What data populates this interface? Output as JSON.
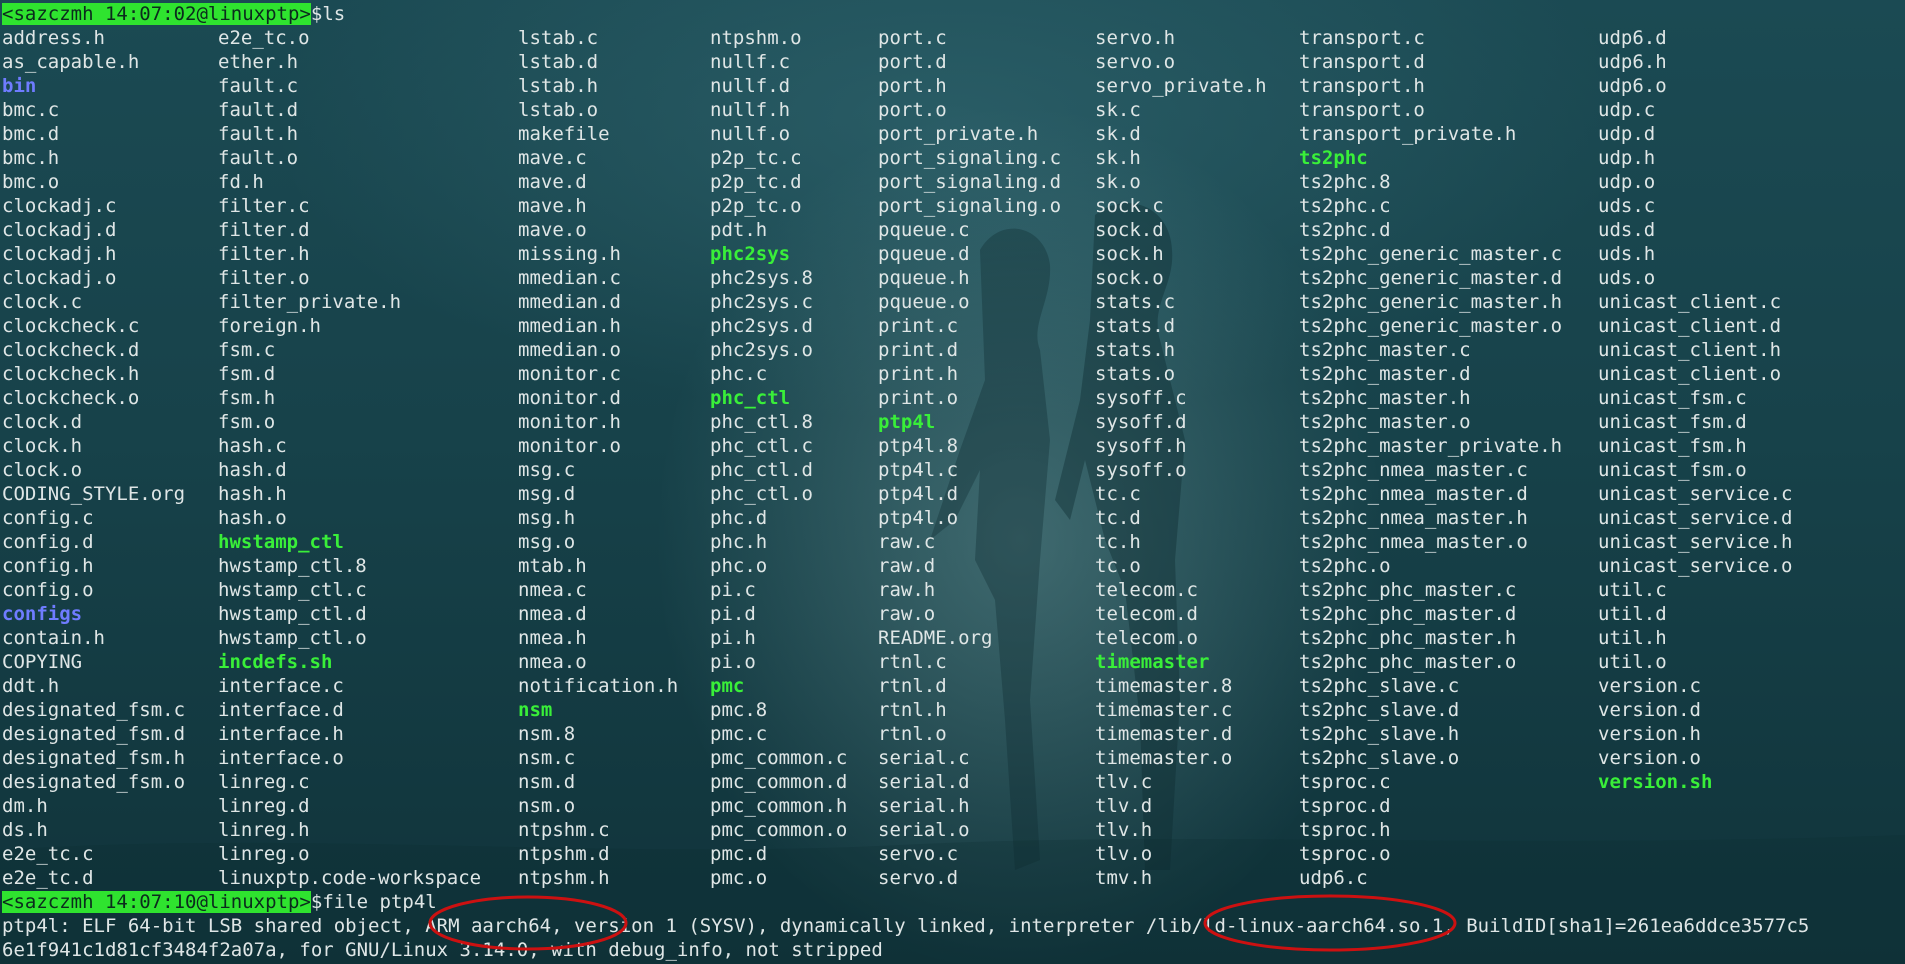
{
  "terminal": {
    "prompt1": {
      "user_host": "<sazczmh 14:07:02@linuxptp>",
      "dollar": "$",
      "command": "ls"
    },
    "prompt2": {
      "user_host": "<sazczmh 14:07:10@linuxptp>",
      "dollar": "$",
      "command": "file ptp4l"
    },
    "output_line1": "ptp4l: ELF 64-bit LSB shared object, ARM aarch64, version 1 (SYSV), dynamically linked, interpreter /lib/ld-linux-aarch64.so.1, BuildID[sha1]=261ea6ddce3577c5",
    "output_line2": "6e1f941c1d81cf3484f2a07a, for GNU/Linux 3.14.0, with debug_info, not stripped"
  },
  "colors": {
    "prompt_bg": "#2fe32f",
    "text": "#dfe6e6",
    "directory": "#6f7cff",
    "executable": "#39ef39",
    "annotation": "#cc1111"
  },
  "ls_columns": [
    [
      "address.h",
      "as_capable.h",
      {
        "n": "bin",
        "t": "dir"
      },
      "bmc.c",
      "bmc.d",
      "bmc.h",
      "bmc.o",
      "clockadj.c",
      "clockadj.d",
      "clockadj.h",
      "clockadj.o",
      "clock.c",
      "clockcheck.c",
      "clockcheck.d",
      "clockcheck.h",
      "clockcheck.o",
      "clock.d",
      "clock.h",
      "clock.o",
      "CODING_STYLE.org",
      "config.c",
      "config.d",
      "config.h",
      "config.o",
      {
        "n": "configs",
        "t": "dir"
      },
      "contain.h",
      "COPYING",
      "ddt.h",
      "designated_fsm.c",
      "designated_fsm.d",
      "designated_fsm.h",
      "designated_fsm.o",
      "dm.h",
      "ds.h",
      "e2e_tc.c",
      "e2e_tc.d"
    ],
    [
      "e2e_tc.o",
      "ether.h",
      "fault.c",
      "fault.d",
      "fault.h",
      "fault.o",
      "fd.h",
      "filter.c",
      "filter.d",
      "filter.h",
      "filter.o",
      "filter_private.h",
      "foreign.h",
      "fsm.c",
      "fsm.d",
      "fsm.h",
      "fsm.o",
      "hash.c",
      "hash.d",
      "hash.h",
      "hash.o",
      {
        "n": "hwstamp_ctl",
        "t": "exe"
      },
      "hwstamp_ctl.8",
      "hwstamp_ctl.c",
      "hwstamp_ctl.d",
      "hwstamp_ctl.o",
      {
        "n": "incdefs.sh",
        "t": "exe"
      },
      "interface.c",
      "interface.d",
      "interface.h",
      "interface.o",
      "linreg.c",
      "linreg.d",
      "linreg.h",
      "linreg.o",
      "linuxptp.code-workspace"
    ],
    [
      "lstab.c",
      "lstab.d",
      "lstab.h",
      "lstab.o",
      "makefile",
      "mave.c",
      "mave.d",
      "mave.h",
      "mave.o",
      "missing.h",
      "mmedian.c",
      "mmedian.d",
      "mmedian.h",
      "mmedian.o",
      "monitor.c",
      "monitor.d",
      "monitor.h",
      "monitor.o",
      "msg.c",
      "msg.d",
      "msg.h",
      "msg.o",
      "mtab.h",
      "nmea.c",
      "nmea.d",
      "nmea.h",
      "nmea.o",
      "notification.h",
      {
        "n": "nsm",
        "t": "exe"
      },
      "nsm.8",
      "nsm.c",
      "nsm.d",
      "nsm.o",
      "ntpshm.c",
      "ntpshm.d",
      "ntpshm.h"
    ],
    [
      "ntpshm.o",
      "nullf.c",
      "nullf.d",
      "nullf.h",
      "nullf.o",
      "p2p_tc.c",
      "p2p_tc.d",
      "p2p_tc.o",
      "pdt.h",
      {
        "n": "phc2sys",
        "t": "exe"
      },
      "phc2sys.8",
      "phc2sys.c",
      "phc2sys.d",
      "phc2sys.o",
      "phc.c",
      {
        "n": "phc_ctl",
        "t": "exe"
      },
      "phc_ctl.8",
      "phc_ctl.c",
      "phc_ctl.d",
      "phc_ctl.o",
      "phc.d",
      "phc.h",
      "phc.o",
      "pi.c",
      "pi.d",
      "pi.h",
      "pi.o",
      {
        "n": "pmc",
        "t": "exe"
      },
      "pmc.8",
      "pmc.c",
      "pmc_common.c",
      "pmc_common.d",
      "pmc_common.h",
      "pmc_common.o",
      "pmc.d",
      "pmc.o"
    ],
    [
      "port.c",
      "port.d",
      "port.h",
      "port.o",
      "port_private.h",
      "port_signaling.c",
      "port_signaling.d",
      "port_signaling.o",
      "pqueue.c",
      "pqueue.d",
      "pqueue.h",
      "pqueue.o",
      "print.c",
      "print.d",
      "print.h",
      "print.o",
      {
        "n": "ptp4l",
        "t": "exe"
      },
      "ptp4l.8",
      "ptp4l.c",
      "ptp4l.d",
      "ptp4l.o",
      "raw.c",
      "raw.d",
      "raw.h",
      "raw.o",
      "README.org",
      "rtnl.c",
      "rtnl.d",
      "rtnl.h",
      "rtnl.o",
      "serial.c",
      "serial.d",
      "serial.h",
      "serial.o",
      "servo.c",
      "servo.d"
    ],
    [
      "servo.h",
      "servo.o",
      "servo_private.h",
      "sk.c",
      "sk.d",
      "sk.h",
      "sk.o",
      "sock.c",
      "sock.d",
      "sock.h",
      "sock.o",
      "stats.c",
      "stats.d",
      "stats.h",
      "stats.o",
      "sysoff.c",
      "sysoff.d",
      "sysoff.h",
      "sysoff.o",
      "tc.c",
      "tc.d",
      "tc.h",
      "tc.o",
      "telecom.c",
      "telecom.d",
      "telecom.o",
      {
        "n": "timemaster",
        "t": "exe"
      },
      "timemaster.8",
      "timemaster.c",
      "timemaster.d",
      "timemaster.o",
      "tlv.c",
      "tlv.d",
      "tlv.h",
      "tlv.o",
      "tmv.h"
    ],
    [
      "transport.c",
      "transport.d",
      "transport.h",
      "transport.o",
      "transport_private.h",
      {
        "n": "ts2phc",
        "t": "exe"
      },
      "ts2phc.8",
      "ts2phc.c",
      "ts2phc.d",
      "ts2phc_generic_master.c",
      "ts2phc_generic_master.d",
      "ts2phc_generic_master.h",
      "ts2phc_generic_master.o",
      "ts2phc_master.c",
      "ts2phc_master.d",
      "ts2phc_master.h",
      "ts2phc_master.o",
      "ts2phc_master_private.h",
      "ts2phc_nmea_master.c",
      "ts2phc_nmea_master.d",
      "ts2phc_nmea_master.h",
      "ts2phc_nmea_master.o",
      "ts2phc.o",
      "ts2phc_phc_master.c",
      "ts2phc_phc_master.d",
      "ts2phc_phc_master.h",
      "ts2phc_phc_master.o",
      "ts2phc_slave.c",
      "ts2phc_slave.d",
      "ts2phc_slave.h",
      "ts2phc_slave.o",
      "tsproc.c",
      "tsproc.d",
      "tsproc.h",
      "tsproc.o",
      "udp6.c"
    ],
    [
      "udp6.d",
      "udp6.h",
      "udp6.o",
      "udp.c",
      "udp.d",
      "udp.h",
      "udp.o",
      "uds.c",
      "uds.d",
      "uds.h",
      "uds.o",
      "unicast_client.c",
      "unicast_client.d",
      "unicast_client.h",
      "unicast_client.o",
      "unicast_fsm.c",
      "unicast_fsm.d",
      "unicast_fsm.h",
      "unicast_fsm.o",
      "unicast_service.c",
      "unicast_service.d",
      "unicast_service.h",
      "unicast_service.o",
      "util.c",
      "util.d",
      "util.h",
      "util.o",
      "version.c",
      "version.d",
      "version.h",
      "version.o",
      {
        "n": "version.sh",
        "t": "exe"
      }
    ]
  ]
}
